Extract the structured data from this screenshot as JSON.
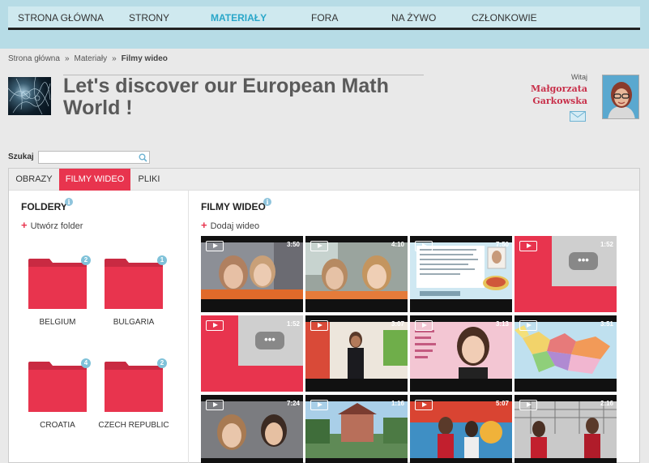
{
  "nav": {
    "items": [
      {
        "label": "Strona główna"
      },
      {
        "label": "Strony"
      },
      {
        "label": "Materiały",
        "active": true
      },
      {
        "label": "Fora"
      },
      {
        "label": "Na żywo"
      },
      {
        "label": "Członkowie"
      }
    ]
  },
  "breadcrumb": {
    "home": "Strona główna",
    "separator": "»",
    "section": "Materiały",
    "current": "Filmy wideo"
  },
  "header": {
    "title": "Let's discover our European Math World !",
    "greeting": "Witaj",
    "user_first": "Małgorzata",
    "user_last": "Garkowska",
    "mail_icon": "envelope-icon",
    "avatar_icon": "user-photo"
  },
  "search": {
    "label": "Szukaj",
    "value": "",
    "placeholder": "",
    "icon": "search-icon"
  },
  "tabs": [
    {
      "label": "Obrazy"
    },
    {
      "label": "Filmy wideo",
      "active": true
    },
    {
      "label": "Pliki"
    }
  ],
  "folders": {
    "title": "Foldery",
    "create_label": "Utwórz folder",
    "items": [
      {
        "name": "Belgium",
        "count": "2"
      },
      {
        "name": "Bulgaria",
        "count": "1"
      },
      {
        "name": "Croatia",
        "count": "4"
      },
      {
        "name": "Czech Republic",
        "count": "2"
      }
    ]
  },
  "videos": {
    "title": "Filmy wideo",
    "add_label": "Dodaj wideo",
    "items": [
      {
        "duration": "3:50",
        "kind": "photo"
      },
      {
        "duration": "4:10",
        "kind": "photo"
      },
      {
        "duration": "7:50",
        "kind": "slide"
      },
      {
        "duration": "1:52",
        "kind": "placeholder"
      },
      {
        "duration": "1:52",
        "kind": "placeholder"
      },
      {
        "duration": "3:07",
        "kind": "photo"
      },
      {
        "duration": "3:13",
        "kind": "photo"
      },
      {
        "duration": "3:51",
        "kind": "map"
      },
      {
        "duration": "7:24",
        "kind": "photo"
      },
      {
        "duration": "1:16",
        "kind": "photo"
      },
      {
        "duration": "5:07",
        "kind": "photo"
      },
      {
        "duration": "2:16",
        "kind": "photo"
      }
    ]
  },
  "colors": {
    "accent": "#e8344e",
    "nav_bg": "#b7dce6",
    "nav_active": "#2aa7c9",
    "badge": "#7fc2d9"
  }
}
